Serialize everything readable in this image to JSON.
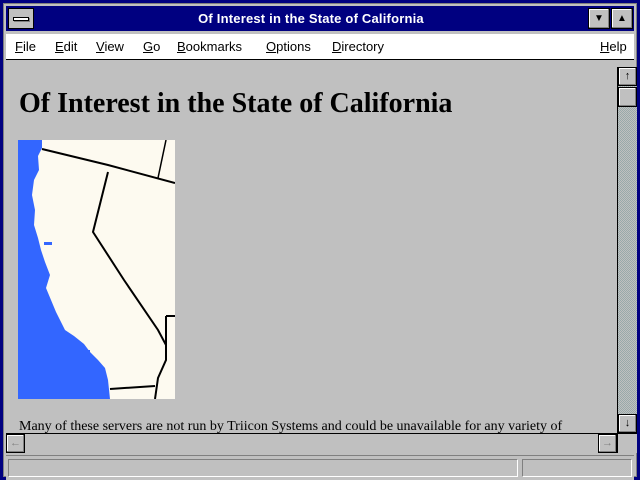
{
  "window": {
    "title": "Of Interest in the State of California"
  },
  "title_buttons": {
    "minimize_glyph": "▼",
    "maximize_glyph": "▲"
  },
  "menu": {
    "items": [
      "File",
      "Edit",
      "View",
      "Go",
      "Bookmarks",
      "Options",
      "Directory"
    ],
    "help": "Help"
  },
  "page": {
    "heading": "Of Interest in the State of California",
    "body_text": "Many of these servers are not run by Triicon Systems and could be unavailable for any variety of"
  },
  "map": {
    "ocean_color": "#3366ff",
    "land_color": "#fdfaf0",
    "border_color": "#000000"
  },
  "scrollbar": {
    "up_glyph": "↑",
    "down_glyph": "↓",
    "left_glyph": "←",
    "right_glyph": "→"
  },
  "status": {
    "text": ""
  }
}
